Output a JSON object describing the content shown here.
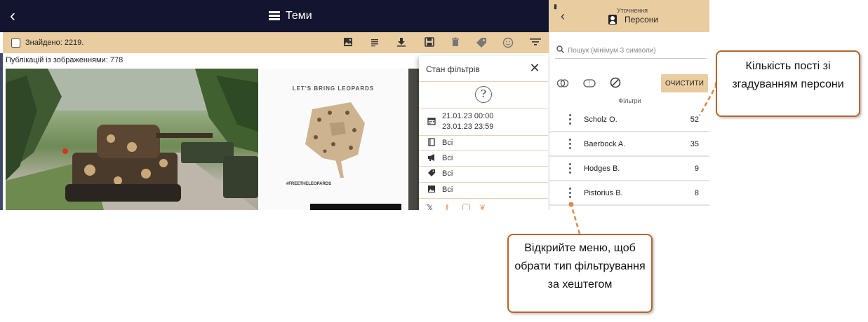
{
  "topbar": {
    "title": "Теми"
  },
  "toolbar": {
    "found_label": "Знайдено: 2219.",
    "icons": [
      "image-icon",
      "text-icon",
      "download-icon",
      "save-icon",
      "delete-icon",
      "tag-icon",
      "emoji-icon",
      "filter-icon"
    ]
  },
  "main": {
    "images_count_label": "Публікацій із зображеннями: 778"
  },
  "image2": {
    "headline": "LET'S BRING LEOPARDS",
    "hashtag": "#FREETHELEOPARDS"
  },
  "filter_panel": {
    "title": "Стан фільтрів",
    "date_from": "21.01.23 00:00",
    "date_to": "23.01.23 23:59",
    "rows": [
      "Всі",
      "Всі",
      "Всі",
      "Всі"
    ]
  },
  "right_panel": {
    "subtitle": "Уточнення",
    "title": "Персони",
    "search_placeholder": "Пошук (мінімум 3 символи)",
    "clear_label": "ОЧИСТИТИ",
    "filters_label": "Фільтри",
    "persons": [
      {
        "name": "Scholz O.",
        "count": "52"
      },
      {
        "name": "Baerbock A.",
        "count": "35"
      },
      {
        "name": "Hodges B.",
        "count": "9"
      },
      {
        "name": "Pistorius B.",
        "count": "8"
      }
    ]
  },
  "callouts": {
    "mentions": "Кількість пості зі згадуванням персони",
    "menu": "Відкрийте меню, щоб обрати тип фільтрування за хештегом"
  },
  "colors": {
    "topbar": "#13142e",
    "accent": "#e9cca0",
    "callout_border": "#b8652a"
  }
}
